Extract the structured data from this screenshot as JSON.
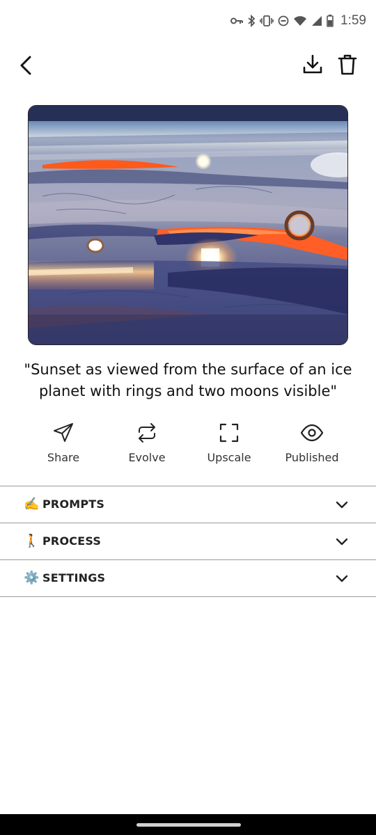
{
  "status_bar": {
    "time": "1:59",
    "icons": [
      "key-icon",
      "bluetooth-icon",
      "vibrate-icon",
      "dnd-icon",
      "wifi-icon",
      "signal-icon",
      "battery-icon"
    ]
  },
  "top_bar": {
    "back_icon": "chevron-left-icon",
    "download_icon": "download-icon",
    "delete_icon": "trash-icon"
  },
  "artwork": {
    "description_icon": "generated-image",
    "colors": {
      "sky_top": "#2a3150",
      "horizon_glow": "#ff5a1f",
      "ice": "#b9bccb",
      "shadow": "#1c2250"
    }
  },
  "prompt_caption": "\"Sunset as viewed from the surface of an ice planet with rings and two moons visible\"",
  "actions": [
    {
      "label": "Share",
      "icon": "send-icon"
    },
    {
      "label": "Evolve",
      "icon": "repeat-icon"
    },
    {
      "label": "Upscale",
      "icon": "expand-icon"
    },
    {
      "label": "Published",
      "icon": "eye-icon"
    }
  ],
  "sections": [
    {
      "emoji": "✍️",
      "label": "PROMPTS",
      "icon": "chevron-down-icon"
    },
    {
      "emoji": "🚶",
      "label": "PROCESS",
      "icon": "chevron-down-icon"
    },
    {
      "emoji": "⚙️",
      "label": "SETTINGS",
      "icon": "chevron-down-icon"
    }
  ]
}
